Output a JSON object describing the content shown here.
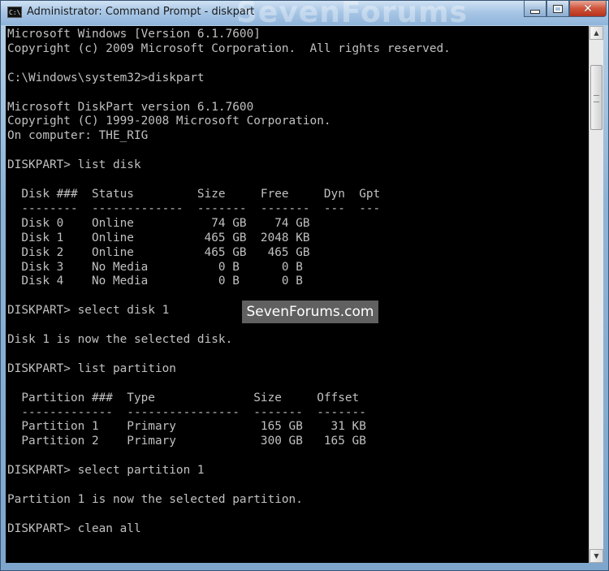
{
  "window": {
    "title": "Administrator: Command Prompt - diskpart",
    "icon_label": "C:\\."
  },
  "watermarks": {
    "title_watermark": "SevenForums",
    "middle_watermark": "SevenForums.com"
  },
  "caption_buttons": {
    "close_glyph": "✕"
  },
  "scrollbar": {
    "up_arrow": "▲",
    "down_arrow": "▼"
  },
  "console": {
    "lines": [
      "Microsoft Windows [Version 6.1.7600]",
      "Copyright (c) 2009 Microsoft Corporation.  All rights reserved.",
      "",
      "C:\\Windows\\system32>diskpart",
      "",
      "Microsoft DiskPart version 6.1.7600",
      "Copyright (C) 1999-2008 Microsoft Corporation.",
      "On computer: THE_RIG",
      "",
      "DISKPART> list disk",
      "",
      "  Disk ###  Status         Size     Free     Dyn  Gpt",
      "  --------  -------------  -------  -------  ---  ---",
      "  Disk 0    Online           74 GB    74 GB",
      "  Disk 1    Online          465 GB  2048 KB",
      "  Disk 2    Online          465 GB   465 GB",
      "  Disk 3    No Media          0 B      0 B",
      "  Disk 4    No Media          0 B      0 B",
      "",
      "DISKPART> select disk 1",
      "",
      "Disk 1 is now the selected disk.",
      "",
      "DISKPART> list partition",
      "",
      "  Partition ###  Type              Size     Offset",
      "  -------------  ----------------  -------  -------",
      "  Partition 1    Primary            165 GB    31 KB",
      "  Partition 2    Primary            300 GB   165 GB",
      "",
      "DISKPART> select partition 1",
      "",
      "Partition 1 is now the selected partition.",
      "",
      "DISKPART> clean all"
    ]
  }
}
